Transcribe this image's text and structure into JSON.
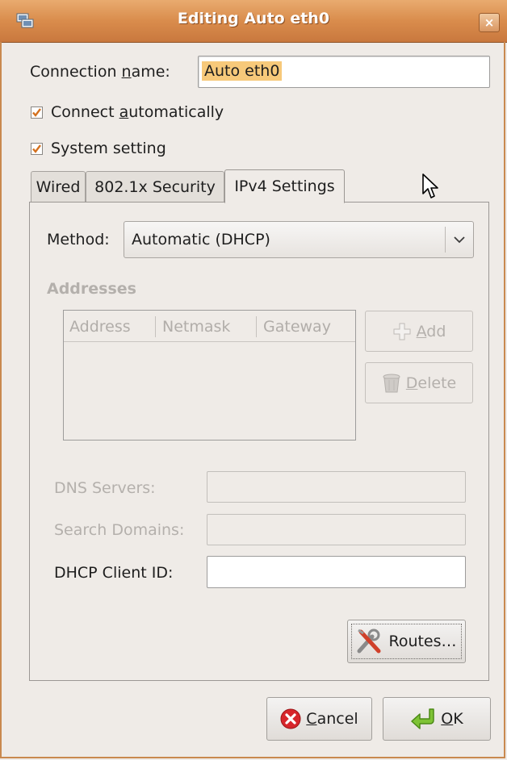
{
  "window": {
    "title": "Editing Auto eth0",
    "close_symbol": "×"
  },
  "connection": {
    "name_label_pre": "Connection ",
    "name_label_u": "n",
    "name_label_post": "ame:",
    "name_value": "Auto eth0"
  },
  "checkboxes": [
    {
      "pre": "Connect ",
      "u": "a",
      "post": "utomatically",
      "checked": true
    },
    {
      "pre": "System setting",
      "u": "",
      "post": "",
      "checked": true
    }
  ],
  "tabs": [
    {
      "label": "Wired",
      "active": false
    },
    {
      "label": "802.1x Security",
      "active": false
    },
    {
      "label": "IPv4 Settings",
      "active": true
    }
  ],
  "ipv4": {
    "method_label": "Method:",
    "method_value": "Automatic (DHCP)",
    "addresses_title": "Addresses",
    "columns": [
      "Address",
      "Netmask",
      "Gateway"
    ],
    "add_button": {
      "u": "A",
      "post": "dd"
    },
    "delete_button": {
      "u": "D",
      "post": "elete"
    },
    "dns_label": "DNS Servers:",
    "dns_value": "",
    "search_label": "Search Domains:",
    "search_value": "",
    "dhcp_label": "DHCP Client ID:",
    "dhcp_value": "",
    "routes_button": "Routes…"
  },
  "footer": {
    "cancel": {
      "u": "C",
      "post": "ancel"
    },
    "ok": {
      "u": "O",
      "post": "K"
    }
  },
  "colors": {
    "titlebar": "#d98c4c",
    "window_bg": "#efebe7",
    "selection": "#f7c97a",
    "check_mark": "#d4711f"
  },
  "icons": {
    "window": "network-connection-icon",
    "close": "close-icon",
    "combo": "chevron-down-icon",
    "add": "plus-icon",
    "delete": "trash-icon",
    "routes": "tools-icon",
    "cancel": "cancel-icon",
    "ok": "ok-arrow-icon",
    "cursor": "mouse-pointer-icon"
  }
}
